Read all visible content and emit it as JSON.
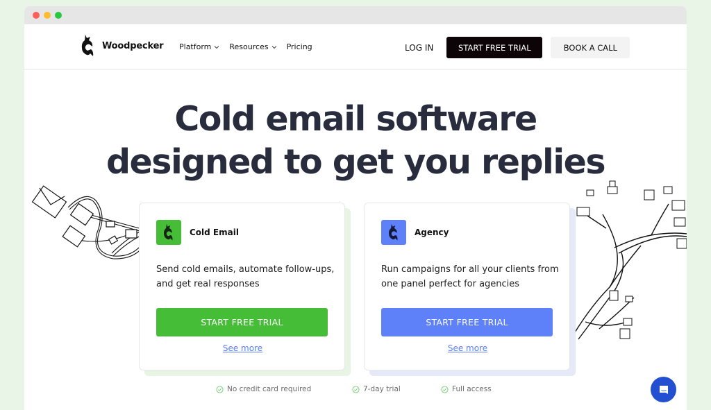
{
  "window": {
    "controls": [
      "close",
      "minimize",
      "maximize"
    ]
  },
  "nav": {
    "brand": "Woodpecker",
    "menu": [
      {
        "label": "Platform",
        "has_dropdown": true
      },
      {
        "label": "Resources",
        "has_dropdown": true
      },
      {
        "label": "Pricing",
        "has_dropdown": false
      }
    ],
    "login": "LOG IN",
    "start_trial": "START FREE TRIAL",
    "book_call": "BOOK A CALL"
  },
  "hero": {
    "title_line1": "Cold email software",
    "title_line2": "designed to get you replies"
  },
  "cards": [
    {
      "title": "Cold Email",
      "description": "Send cold emails, automate follow-ups, and get real responses",
      "button": "START FREE TRIAL",
      "link": "See more",
      "accent": "#46bd37",
      "shadow": "#e8f5e5"
    },
    {
      "title": "Agency",
      "description": "Run campaigns for all your clients from one panel perfect for agencies",
      "button": "START FREE TRIAL",
      "link": "See more",
      "accent": "#5e80f8",
      "shadow": "#e6e9f7"
    }
  ],
  "perks": [
    "No credit card required",
    "7-day trial",
    "Full access"
  ],
  "colors": {
    "heading": "#282c3d",
    "link": "#5b7ff8",
    "check": "#6ccf72",
    "chat": "#2250d0"
  },
  "icons": {
    "logo": "woodpecker-logo-icon",
    "chat": "chat-bubble-icon",
    "check": "check-circle-icon"
  }
}
